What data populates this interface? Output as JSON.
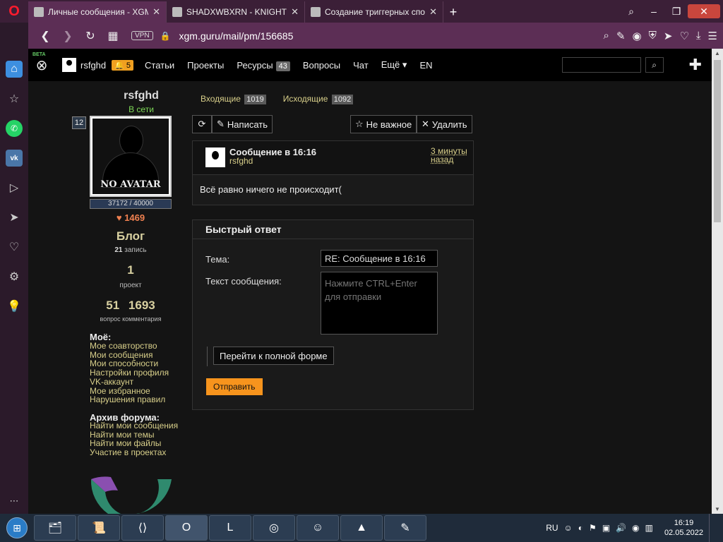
{
  "browser": {
    "tabs": [
      {
        "title": "Личные сообщения - XGM",
        "active": true
      },
      {
        "title": "SHADXWBXRN - KNIGHT -",
        "active": false
      },
      {
        "title": "Создание триггерных спо",
        "active": false
      }
    ],
    "vpn_label": "VPN",
    "url_host": "xgm.guru",
    "url_path": "/mail/pm/156685"
  },
  "site_header": {
    "beta": "BETA",
    "username": "rsfghd",
    "notif_count": "5",
    "nav": [
      {
        "label": "Статьи"
      },
      {
        "label": "Проекты"
      },
      {
        "label": "Ресурсы",
        "badge": "43"
      },
      {
        "label": "Вопросы"
      },
      {
        "label": "Чат"
      },
      {
        "label": "Ещё"
      },
      {
        "label": "EN"
      }
    ]
  },
  "profile": {
    "name": "rsfghd",
    "status": "В сети",
    "level": "12",
    "avatar_text": "NO AVATAR",
    "xp": "37172 / 40000",
    "likes": "1469",
    "blog_title": "Блог",
    "blog_count": "21",
    "blog_unit": "запись",
    "projects_count": "1",
    "projects_label": "проект",
    "questions_count": "51",
    "comments_count": "1693",
    "qa_label": "вопрос комментария",
    "mine_header": "Моё:",
    "mine_links": [
      "Мое соавторство",
      "Мои сообщения",
      "Мои способности",
      "Настройки профиля",
      "VK-аккаунт",
      "Мое избранное",
      "Нарушения правил"
    ],
    "archive_header": "Архив форума:",
    "archive_links": [
      "Найти мои сообщения",
      "Найти мои темы",
      "Найти мои файлы",
      "Участие в проектах"
    ]
  },
  "mail": {
    "inbox_label": "Входящие",
    "inbox_count": "1019",
    "outbox_label": "Исходящие",
    "outbox_count": "1092",
    "compose_label": "Написать",
    "not_important_label": "Не важное",
    "delete_label": "Удалить",
    "message": {
      "title": "Сообщение в 16:16",
      "author": "rsfghd",
      "time": "3 минуты назад",
      "body": "Всё равно ничего не происходит("
    }
  },
  "quick_reply": {
    "title": "Быстрый ответ",
    "subject_label": "Тема:",
    "subject_value": "RE: Сообщение в 16:16",
    "text_label": "Текст сообщения:",
    "text_placeholder": "Нажмите CTRL+Enter для отправки",
    "full_form_label": "Перейти к полной форме",
    "send_label": "Отправить"
  },
  "taskbar": {
    "lang": "RU",
    "time": "16:19",
    "date": "02.05.2022"
  },
  "colors": {
    "accent_orange": "#f7941d",
    "link_gold": "#d8cf8a",
    "online_green": "#7ed957",
    "opera_red": "#ff1b2d"
  }
}
